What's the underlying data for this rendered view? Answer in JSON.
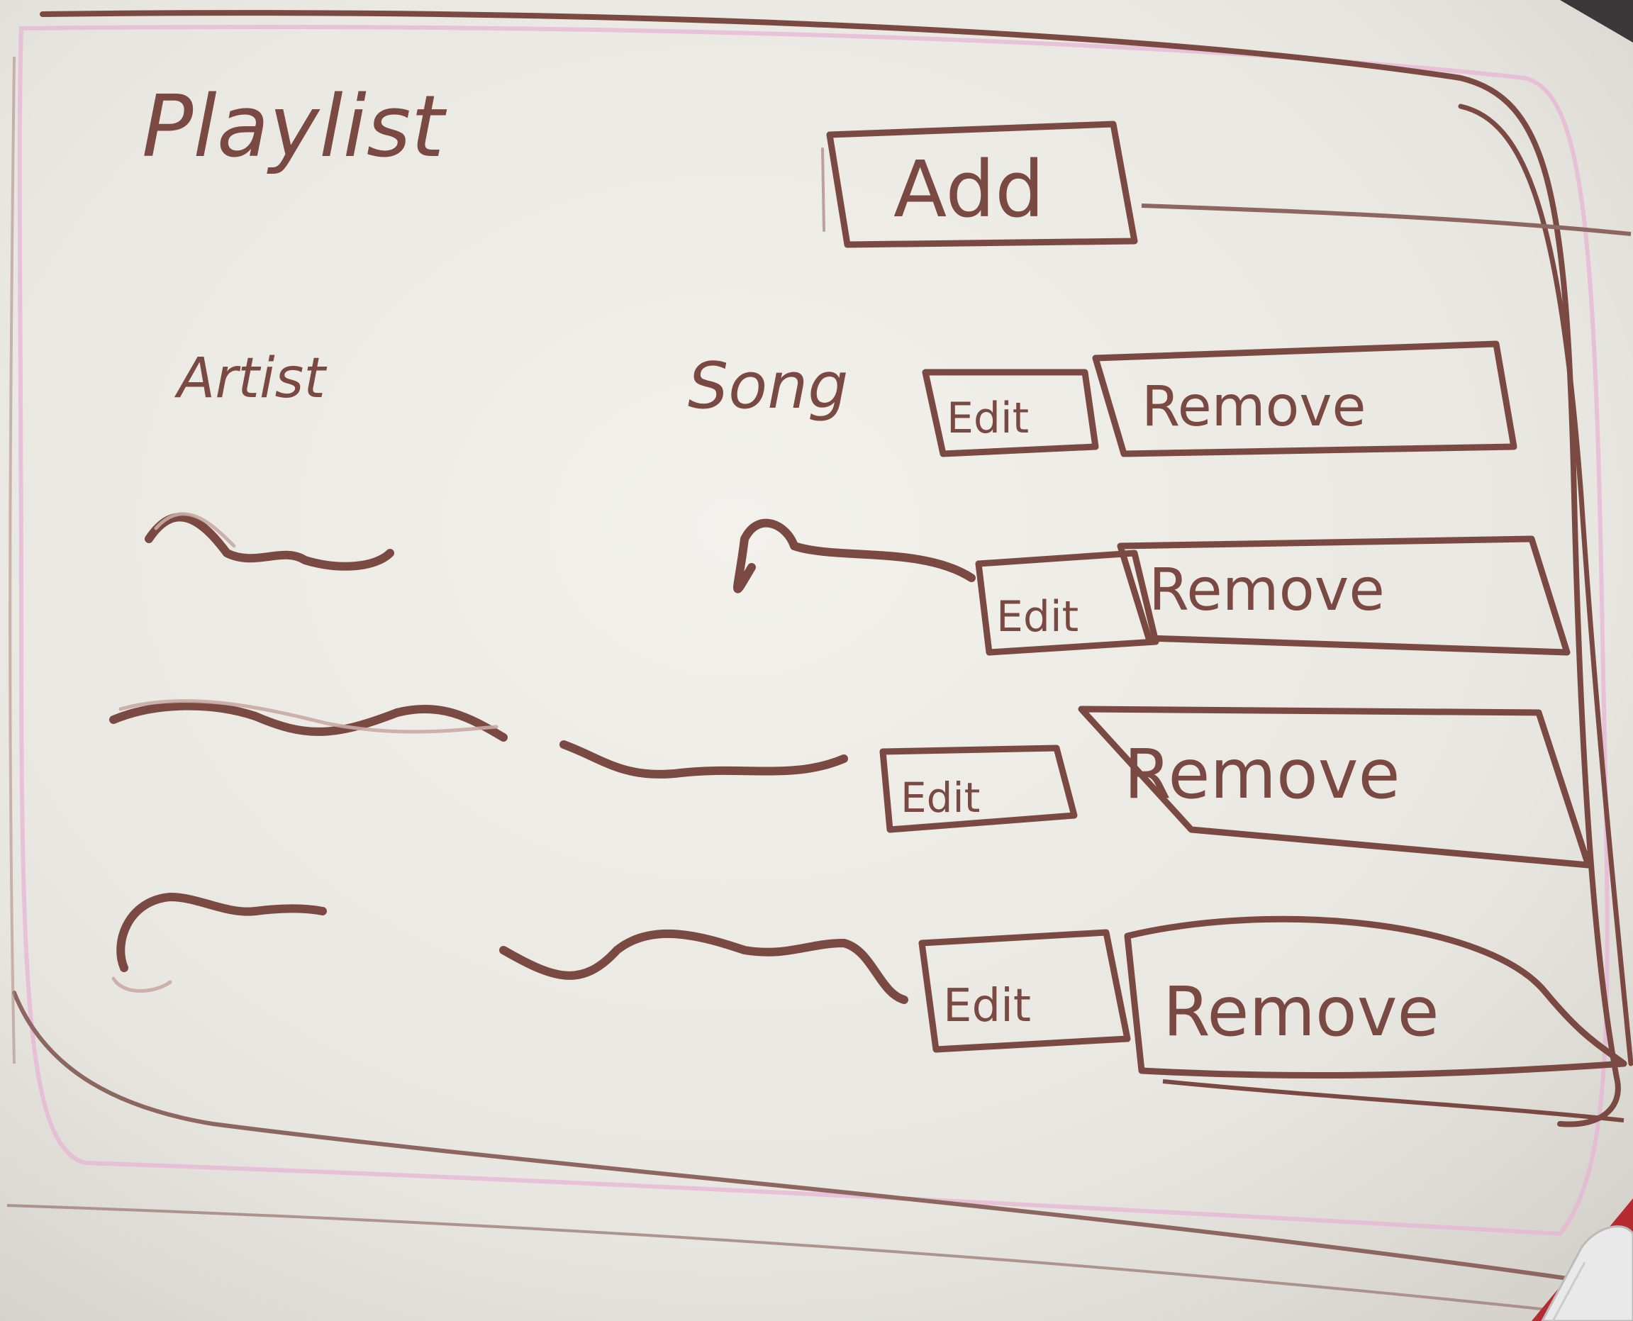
{
  "header": {
    "title": "Playlist",
    "add_label": "Add"
  },
  "columns": {
    "artist": "Artist",
    "song": "Song"
  },
  "rows": [
    {
      "edit_label": "Edit",
      "remove_label": "Remove"
    },
    {
      "edit_label": "Edit",
      "remove_label": "Remove"
    },
    {
      "edit_label": "Edit",
      "remove_label": "Remove"
    },
    {
      "edit_label": "Edit",
      "remove_label": "Remove"
    }
  ],
  "first_row": {
    "edit_label": "Edit",
    "remove_label": "Remove"
  },
  "colors": {
    "ink": "#7a4a42",
    "board": "#efeee9",
    "board_frame_pink": "#e7b4d6",
    "background": "#3f3d3d"
  },
  "icons": {
    "marker": "whiteboard-marker-icon"
  }
}
